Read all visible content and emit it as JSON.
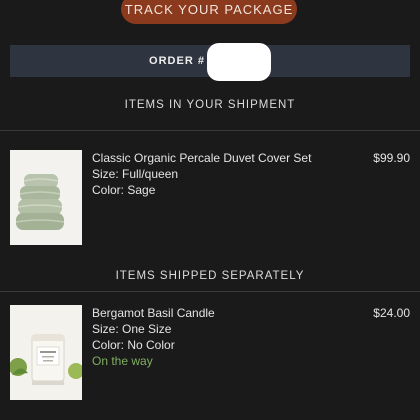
{
  "track_button_label": "TRACK YOUR PACKAGE",
  "order": {
    "label": "ORDER #"
  },
  "shipment": {
    "title": "ITEMS IN YOUR SHIPMENT",
    "items": [
      {
        "name": "Classic Organic Percale Duvet Cover Set",
        "size": "Size: Full/queen",
        "color": "Color: Sage",
        "price": "$99.90",
        "image_icon": "folded-duvet-image"
      }
    ]
  },
  "separate": {
    "title": "ITEMS SHIPPED SEPARATELY",
    "items": [
      {
        "name": "Bergamot Basil Candle",
        "size": "Size: One Size",
        "color": "Color: No Color",
        "status": "On the way",
        "price": "$24.00",
        "image_icon": "candle-image"
      }
    ]
  },
  "colors": {
    "background": "#1a1a1a",
    "track_button": "#8b3a1e",
    "order_bar": "#2f3441",
    "status_green": "#7fae62"
  }
}
